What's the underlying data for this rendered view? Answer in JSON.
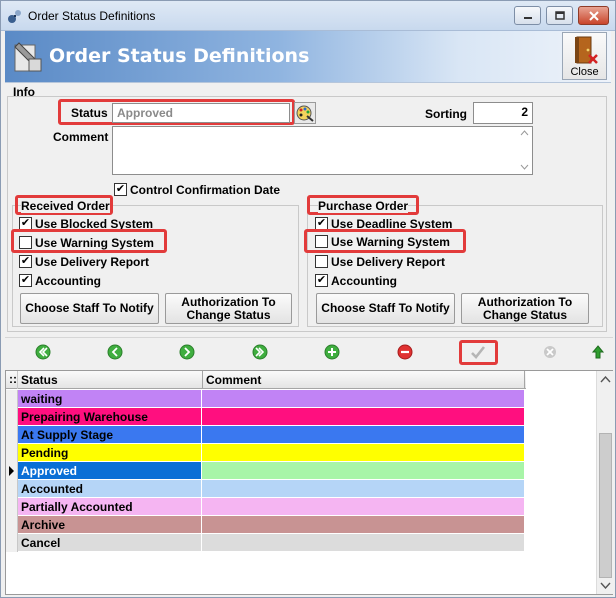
{
  "window": {
    "title": "Order Status Definitions"
  },
  "header": {
    "title": "Order Status Definitions",
    "close_label": "Close"
  },
  "info": {
    "group_label": "Info",
    "status_label": "Status",
    "status_value": "Approved",
    "sorting_label": "Sorting",
    "sorting_value": "2",
    "comment_label": "Comment",
    "comment_value": "",
    "control_confirmation": {
      "label": "Control Confirmation Date",
      "checked": true
    }
  },
  "received_order": {
    "label": "Received Order",
    "options": [
      {
        "label": "Use Blocked System",
        "checked": true
      },
      {
        "label": "Use Warning System",
        "checked": false
      },
      {
        "label": "Use Delivery Report",
        "checked": true
      },
      {
        "label": "Accounting",
        "checked": true
      }
    ],
    "notify_button": "Choose Staff To Notify",
    "auth_button": "Authorization To Change Status"
  },
  "purchase_order": {
    "label": "Purchase Order",
    "options": [
      {
        "label": "Use Deadline System",
        "checked": true
      },
      {
        "label": "Use Warning System",
        "checked": false
      },
      {
        "label": "Use Delivery Report",
        "checked": false
      },
      {
        "label": "Accounting",
        "checked": true
      }
    ],
    "notify_button": "Choose Staff To Notify",
    "auth_button": "Authorization To Change Status"
  },
  "navigator": {
    "buttons": [
      "first-icon",
      "prior-icon",
      "next-icon",
      "last-icon",
      "insert-icon",
      "delete-icon",
      "post-icon",
      "cancel-icon",
      "refresh-icon"
    ]
  },
  "grid": {
    "columns": [
      "Status",
      "Comment"
    ],
    "rows": [
      {
        "status": "waiting",
        "comment": "",
        "color": "#c183f5"
      },
      {
        "status": "Prepairing Warehouse",
        "comment": "",
        "color": "#ff0f7f"
      },
      {
        "status": "At Supply Stage",
        "comment": "",
        "color": "#3a78f0"
      },
      {
        "status": "Pending",
        "comment": "",
        "color": "#ffff00"
      },
      {
        "status": "Approved",
        "comment": "",
        "color": "#a8f5a8",
        "selected": true
      },
      {
        "status": "Accounted",
        "comment": "",
        "color": "#b5d5f7"
      },
      {
        "status": "Partially Accounted",
        "comment": "",
        "color": "#f5b5f2"
      },
      {
        "status": "Archive",
        "comment": "",
        "color": "#c89393"
      },
      {
        "status": "Cancel",
        "comment": "",
        "color": "#dcdcdc"
      }
    ]
  },
  "colors": {
    "highlight": "#e23b3b",
    "selected_status": "#0a6fd6"
  }
}
